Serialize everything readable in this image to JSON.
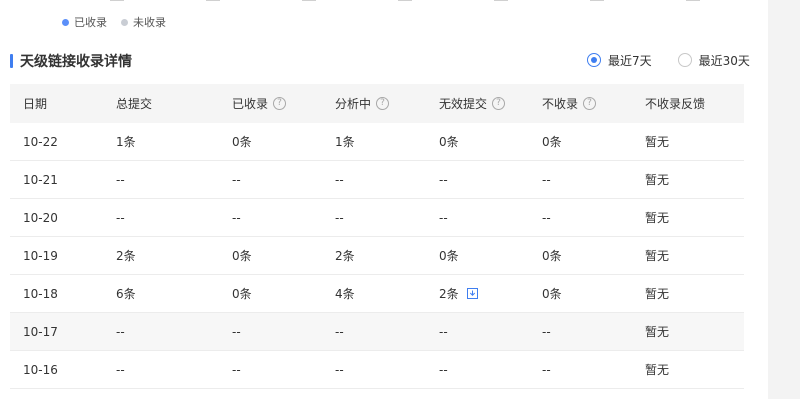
{
  "legend": [
    {
      "label": "已收录",
      "color": "#5b8ff9"
    },
    {
      "label": "未收录",
      "color": "#c9cdd4"
    }
  ],
  "section": {
    "title": "天级链接收录详情"
  },
  "range": {
    "options": [
      "最近7天",
      "最近30天"
    ],
    "selected": "最近7天"
  },
  "table": {
    "headers": [
      "日期",
      "总提交",
      "已收录",
      "分析中",
      "无效提交",
      "不收录",
      "不收录反馈"
    ],
    "help_columns": [
      2,
      3,
      4,
      5
    ],
    "rows": [
      [
        "10-22",
        "1条",
        "0条",
        "1条",
        "0条",
        "0条",
        "暂无"
      ],
      [
        "10-21",
        "--",
        "--",
        "--",
        "--",
        "--",
        "暂无"
      ],
      [
        "10-20",
        "--",
        "--",
        "--",
        "--",
        "--",
        "暂无"
      ],
      [
        "10-19",
        "2条",
        "0条",
        "2条",
        "0条",
        "0条",
        "暂无"
      ],
      [
        "10-18",
        "6条",
        "0条",
        "4条",
        "2条",
        "0条",
        "暂无"
      ],
      [
        "10-17",
        "--",
        "--",
        "--",
        "--",
        "--",
        "暂无"
      ],
      [
        "10-16",
        "--",
        "--",
        "--",
        "--",
        "--",
        "暂无"
      ]
    ],
    "highlighted_row": 5,
    "download_cell": {
      "row": 4,
      "col": 4,
      "icon": "download-icon"
    }
  },
  "colors": {
    "accent": "#3f7ef0",
    "header_bg": "#f5f5f5",
    "gutter": "#f3f3f3"
  }
}
